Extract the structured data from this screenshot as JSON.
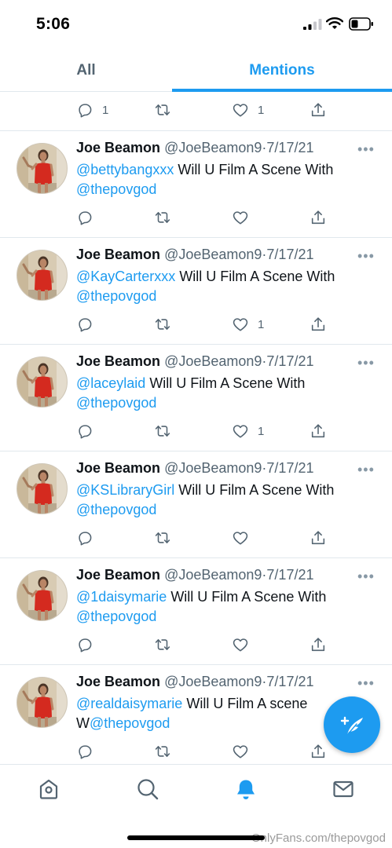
{
  "status_bar": {
    "time": "5:06"
  },
  "tabs": [
    {
      "label": "All"
    },
    {
      "label": "Mentions"
    }
  ],
  "top_partial": {
    "reply_count": "1",
    "like_count": "1"
  },
  "tweets": [
    {
      "name": "Joe Beamon",
      "handle": "@JoeBeamon9",
      "separator": "·",
      "date": "7/17/21",
      "mention": "@bettybangxxx",
      "text": " Will U Film A Scene With ",
      "tag": "@thepovgod",
      "like_count": ""
    },
    {
      "name": "Joe Beamon",
      "handle": "@JoeBeamon9",
      "separator": "·",
      "date": "7/17/21",
      "mention": "@KayCarterxxx",
      "text": " Will U Film A Scene With ",
      "tag": "@thepovgod",
      "like_count": "1"
    },
    {
      "name": "Joe Beamon",
      "handle": "@JoeBeamon9",
      "separator": "·",
      "date": "7/17/21",
      "mention": "@laceylaid",
      "text": " Will U Film A Scene With ",
      "tag": "@thepovgod",
      "like_count": "1"
    },
    {
      "name": "Joe Beamon",
      "handle": "@JoeBeamon9",
      "separator": "·",
      "date": "7/17/21",
      "mention": "@KSLibraryGirl",
      "text": " Will U Film A Scene With ",
      "tag": "@thepovgod",
      "like_count": ""
    },
    {
      "name": "Joe Beamon",
      "handle": "@JoeBeamon9",
      "separator": "·",
      "date": "7/17/21",
      "mention": "@1daisymarie",
      "text": " Will U Film A Scene With ",
      "tag": "@thepovgod",
      "like_count": ""
    },
    {
      "name": "Joe Beamon",
      "handle": "@JoeBeamon9",
      "separator": "·",
      "date": "7/17/21",
      "mention": "@realdaisymarie",
      "text": " Will U Film A scene W",
      "tag": "@thepovgod",
      "like_count": ""
    }
  ],
  "more_label": "•••",
  "watermark": "OnlyFans.com/thepovgod",
  "icons": {
    "reply": "reply-icon",
    "retweet": "retweet-icon",
    "like": "heart-icon",
    "share": "share-icon",
    "compose": "compose-tweet-icon",
    "home": "home-icon",
    "search": "search-icon",
    "notifications": "bell-icon",
    "messages": "mail-icon"
  },
  "colors": {
    "accent": "#1d9bf0",
    "text": "#0f1419",
    "secondary": "#536471",
    "divider": "#e1e8ed"
  }
}
